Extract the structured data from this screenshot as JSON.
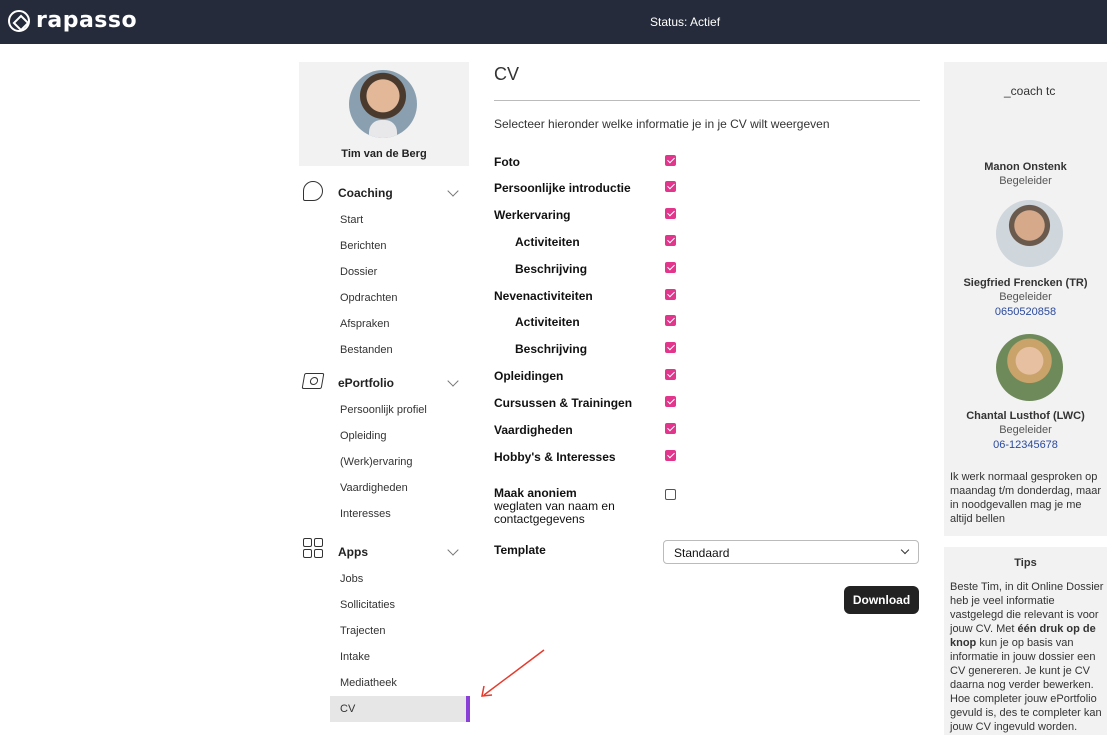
{
  "header": {
    "brand": "rapasso",
    "status": "Status: Actief"
  },
  "profile": {
    "name": "Tim van de Berg"
  },
  "sidebar": {
    "sections": [
      {
        "title": "Coaching",
        "icon": "chat-bubbles-icon",
        "items": [
          "Start",
          "Berichten",
          "Dossier",
          "Opdrachten",
          "Afspraken",
          "Bestanden"
        ]
      },
      {
        "title": "ePortfolio",
        "icon": "portfolio-icon",
        "items": [
          "Persoonlijk profiel",
          "Opleiding",
          "(Werk)ervaring",
          "Vaardigheden",
          "Interesses"
        ]
      },
      {
        "title": "Apps",
        "icon": "apps-grid-icon",
        "items": [
          "Jobs",
          "Sollicitaties",
          "Trajecten",
          "Intake",
          "Mediatheek",
          "CV"
        ]
      }
    ],
    "active_item": "CV"
  },
  "main": {
    "title": "CV",
    "intro": "Selecteer hieronder welke informatie je in je CV wilt weergeven",
    "options": [
      {
        "label": "Foto",
        "checked": true,
        "indent": false
      },
      {
        "label": "Persoonlijke introductie",
        "checked": true,
        "indent": false
      },
      {
        "label": "Werkervaring",
        "checked": true,
        "indent": false
      },
      {
        "label": "Activiteiten",
        "checked": true,
        "indent": true
      },
      {
        "label": "Beschrijving",
        "checked": true,
        "indent": true
      },
      {
        "label": "Nevenactiviteiten",
        "checked": true,
        "indent": false
      },
      {
        "label": "Activiteiten",
        "checked": true,
        "indent": true
      },
      {
        "label": "Beschrijving",
        "checked": true,
        "indent": true
      },
      {
        "label": "Opleidingen",
        "checked": true,
        "indent": false
      },
      {
        "label": "Cursussen & Trainingen",
        "checked": true,
        "indent": false
      },
      {
        "label": "Vaardigheden",
        "checked": true,
        "indent": false
      },
      {
        "label": "Hobby's & Interesses",
        "checked": true,
        "indent": false
      }
    ],
    "anonymous": {
      "label": "Maak anoniem",
      "sublabel": "weglaten van naam en contactgegevens",
      "checked": false
    },
    "template": {
      "label": "Template",
      "value": "Standaard"
    },
    "download_label": "Download",
    "checkbox_color": "#e2358c"
  },
  "coaches": {
    "logo_text": "_coach tc",
    "list": [
      {
        "name": "Manon Onstenk",
        "role": "Begeleider",
        "phone": ""
      },
      {
        "name": "Siegfried Frencken (TR)",
        "role": "Begeleider",
        "phone": "0650520858"
      },
      {
        "name": "Chantal Lusthof (LWC)",
        "role": "Begeleider",
        "phone": "06-12345678"
      }
    ],
    "note": "Ik werk normaal gesproken op maandag t/m donderdag, maar in noodgevallen mag je me altijd bellen"
  },
  "tips": {
    "title": "Tips",
    "text_before": "Beste Tim, in dit Online Dossier heb je veel informatie vastgelegd die relevant is voor jouw CV. Met ",
    "text_bold": "één druk op de knop",
    "text_after": " kun je op basis van informatie in jouw dossier een CV genereren. Je kunt je CV daarna nog verder bewerken. Hoe completer jouw ePortfolio gevuld is, des te completer kan jouw CV ingevuld worden."
  },
  "colors": {
    "topbar": "#252b3a",
    "active_accent": "#8a3fd8",
    "link": "#2b4a9e",
    "annotation_arrow": "#e53b2c"
  }
}
